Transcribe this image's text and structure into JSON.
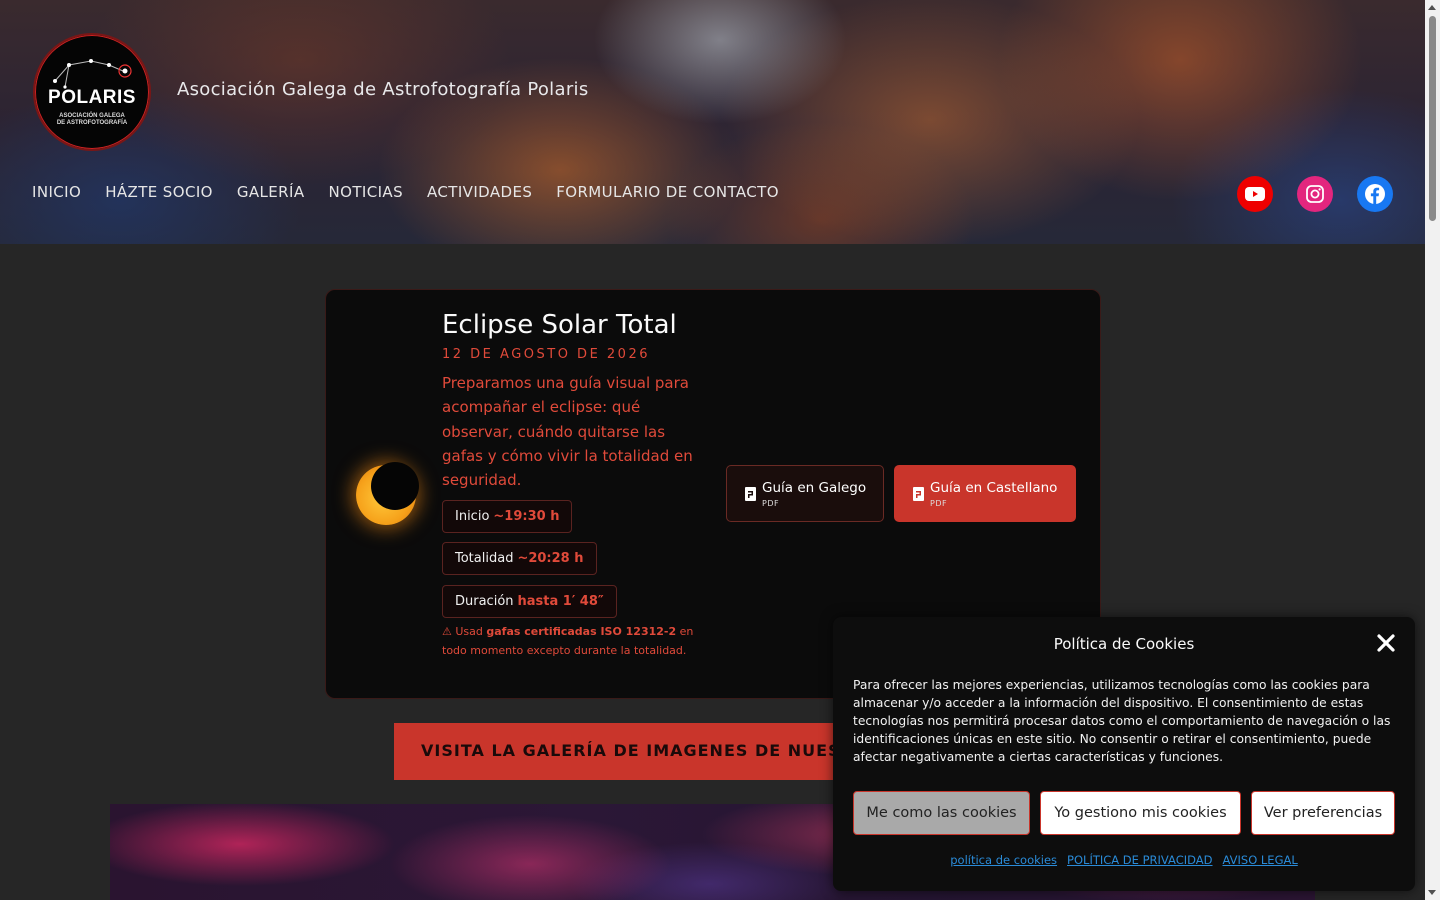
{
  "header": {
    "logo": {
      "title": "POLARIS",
      "subtitle_line1": "ASOCIACIÓN GALEGA",
      "subtitle_line2": "DE ASTROFOTOGRAFÍA"
    },
    "site_title": "Asociación Galega de Astrofotografía Polaris",
    "nav": [
      {
        "label": "INICIO"
      },
      {
        "label": "HÁZTE SOCIO"
      },
      {
        "label": "GALERÍA"
      },
      {
        "label": "NOTICIAS"
      },
      {
        "label": "ACTIVIDADES"
      },
      {
        "label": "FORMULARIO DE CONTACTO"
      }
    ],
    "socials": [
      {
        "icon": "youtube-icon",
        "color": "#ee0000"
      },
      {
        "icon": "instagram-icon",
        "color": "#e3267e"
      },
      {
        "icon": "facebook-icon",
        "color": "#1878f2"
      }
    ]
  },
  "eclipse_card": {
    "title": "Eclipse Solar Total",
    "date": "12 DE AGOSTO DE 2026",
    "description": "Preparamos una guía visual para acompañar el eclipse: qué observar, cuándo quitarse las gafas y cómo vivir la totalidad en seguridad.",
    "times": [
      {
        "label": "Inicio",
        "value": "~19:30 h"
      },
      {
        "label": "Totalidad",
        "value": "~20:28 h"
      },
      {
        "label": "Duración",
        "value": "hasta 1′ 48″"
      }
    ],
    "warning": {
      "prefix": "⚠ Usad ",
      "bold": "gafas certificadas ISO 12312-2",
      "suffix": " en todo momento excepto durante la totalidad."
    },
    "buttons": [
      {
        "label": "Guía en Galego",
        "sub": "PDF"
      },
      {
        "label": "Guía en Castellano",
        "sub": "PDF"
      }
    ],
    "accent_color": "#e04a3a"
  },
  "gallery_banner": {
    "label": "VISITA LA GALERÍA DE IMAGENES DE NUEST"
  },
  "cookie_panel": {
    "title": "Política de Cookies",
    "text": "Para ofrecer las mejores experiencias, utilizamos tecnologías como las cookies para almacenar y/o acceder a la información del dispositivo. El consentimiento de estas tecnologías nos permitirá procesar datos como el comportamiento de navegación o las identificaciones únicas en este sitio. No consentir o retirar el consentimiento, puede afectar negativamente a ciertas características y funciones.",
    "buttons": {
      "accept": "Me como las cookies",
      "manage": "Yo gestiono mis cookies",
      "preferences": "Ver preferencias"
    },
    "links": {
      "cookies": "política de cookies",
      "privacy": "POLÍTICA DE PRIVACIDAD",
      "legal": "AVISO LEGAL"
    }
  }
}
